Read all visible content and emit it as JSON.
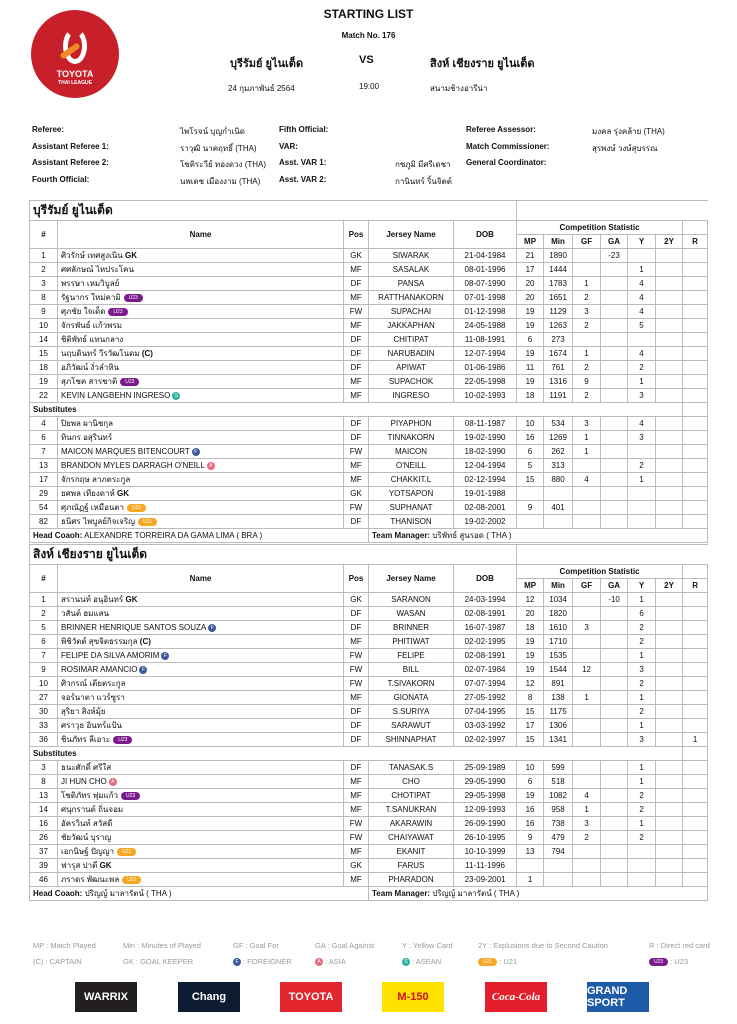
{
  "header": {
    "logo_text": "TOYOTA",
    "logo_sub": "THAI LEAGUE",
    "title": "STARTING LIST",
    "match_no": "Match No. 176",
    "home": "บุรีรัมย์ ยูไนเต็ด",
    "vs": "VS",
    "away": "สิงห์ เชียงราย ยูไนเต็ด",
    "date": "24 กุมภาพันธ์ 2564",
    "time": "19:00",
    "venue": "สนามช้างอารีน่า"
  },
  "officials": [
    {
      "label": "Referee:",
      "value": "ไพโรจน์ บุญก่ำเนิด"
    },
    {
      "label": "Assistant Referee 1:",
      "value": "ราวุฒิ นาคฤทธิ์ (THA)"
    },
    {
      "label": "Assistant Referee 2:",
      "value": "โชติระวีย์ ทองดวง (THA)"
    },
    {
      "label": "Fourth Official:",
      "value": "นพเดช เมืองงาม (THA)"
    },
    {
      "label": "Fifth Official:",
      "value": ""
    },
    {
      "label": "VAR:",
      "value": ""
    },
    {
      "label": "Asst. VAR 1:",
      "value": "กชภูมิ มีศรีเดชา"
    },
    {
      "label": "Asst. VAR 2:",
      "value": "กานินทร์ ริ้นจิตต์"
    },
    {
      "label": "Referee Assessor:",
      "value": "มงคล รุ่งคล้าย (THA)"
    },
    {
      "label": "Match Commissioner:",
      "value": "สุรพงษ์ วงษ์สุบรรณ"
    },
    {
      "label": "General Coordinator:",
      "value": ""
    }
  ],
  "columns": {
    "num": "#",
    "name": "Name",
    "pos": "Pos",
    "jersey": "Jersey Name",
    "dob": "DOB",
    "stat": "Competition Statistic",
    "mp": "MP",
    "min": "Min",
    "gf": "GF",
    "ga": "GA",
    "y": "Y",
    "y2": "2Y",
    "r": "R"
  },
  "subs_label": "Substitutes",
  "coach_label": "Head Coaoh:",
  "manager_label": "Team Manager:",
  "teams": [
    {
      "name": "บุรีรัมย์ ยูไนเต็ด",
      "coach": "ALEXANDRE TORREIRA DA GAMA LIMA ( BRA )",
      "manager": "บริพัทธ์ สูนรอด ( THA )",
      "starters": [
        [
          "1",
          "ศิวรักษ์ เทศสูงเนิน",
          "GK",
          "",
          "GK",
          "SIWARAK",
          "21-04-1984",
          "21",
          "1890",
          "",
          "-23",
          "",
          "",
          ""
        ],
        [
          "2",
          "ศศลักษณ์ ไหประโคน",
          "",
          "",
          "MF",
          "SASALAK",
          "08-01-1996",
          "17",
          "1444",
          "",
          "",
          "1",
          "",
          ""
        ],
        [
          "3",
          "พรรษา เหมวิบูลย์",
          "",
          "",
          "DF",
          "PANSA",
          "08-07-1990",
          "20",
          "1783",
          "1",
          "",
          "4",
          "",
          ""
        ],
        [
          "8",
          "รัฐนากร ใหม่คามิ",
          "",
          "U23",
          "MF",
          "RATTHANAKORN",
          "07-01-1998",
          "20",
          "1651",
          "2",
          "",
          "4",
          "",
          ""
        ],
        [
          "9",
          "ศุภชัย ใจเด็ด",
          "",
          "U23",
          "FW",
          "SUPACHAI",
          "01-12-1998",
          "19",
          "1129",
          "3",
          "",
          "4",
          "",
          ""
        ],
        [
          "10",
          "จักรพันธ์ แก้วพรม",
          "",
          "",
          "MF",
          "JAKKAPHAN",
          "24-05-1988",
          "19",
          "1263",
          "2",
          "",
          "5",
          "",
          ""
        ],
        [
          "14",
          "ชิติพัทธ์ แทนกลาง",
          "",
          "",
          "DF",
          "CHITIPAT",
          "11-08-1991",
          "6",
          "273",
          "",
          "",
          "",
          "",
          ""
        ],
        [
          "15",
          "นฤบดินทร์ วีรวัฒโนดม",
          "(C)",
          "",
          "DF",
          "NARUBADIN",
          "12-07-1994",
          "19",
          "1674",
          "1",
          "",
          "4",
          "",
          ""
        ],
        [
          "18",
          "อภิวัฒน์ งั่วลำหิน",
          "",
          "",
          "DF",
          "APIWAT",
          "01-06-1986",
          "11",
          "761",
          "2",
          "",
          "2",
          "",
          ""
        ],
        [
          "19",
          "สุภโชค สารชาติ",
          "",
          "U23",
          "MF",
          "SUPACHOK",
          "22-05-1998",
          "19",
          "1316",
          "9",
          "",
          "1",
          "",
          ""
        ],
        [
          "22",
          "KEVIN LANGBEHN INGRESO",
          "",
          "S",
          "MF",
          "INGRESO",
          "10-02-1993",
          "18",
          "1191",
          "2",
          "",
          "3",
          "",
          ""
        ]
      ],
      "subs": [
        [
          "4",
          "ปิยพล ผานิชกุล",
          "",
          "",
          "DF",
          "PIYAPHON",
          "08-11-1987",
          "10",
          "534",
          "3",
          "",
          "4",
          "",
          ""
        ],
        [
          "6",
          "ทินกร อสุรินทร์",
          "",
          "",
          "DF",
          "TINNAKORN",
          "19-02-1990",
          "16",
          "1269",
          "1",
          "",
          "3",
          "",
          ""
        ],
        [
          "7",
          "MAICON MARQUES BITENCOURT",
          "",
          "F",
          "FW",
          "MAICON",
          "18-02-1990",
          "6",
          "262",
          "1",
          "",
          "",
          "",
          ""
        ],
        [
          "13",
          "BRANDON MYLES DARRAGH O'NEILL",
          "",
          "A",
          "MF",
          "O'NEILL",
          "12-04-1994",
          "5",
          "313",
          "",
          "",
          "2",
          "",
          ""
        ],
        [
          "17",
          "จักรกฤษ ลาภตระกูล",
          "",
          "",
          "MF",
          "CHAKKIT.L",
          "02-12-1994",
          "15",
          "880",
          "4",
          "",
          "1",
          "",
          ""
        ],
        [
          "29",
          "ยศพล เทียงดาห์",
          "GK",
          "",
          "GK",
          "YOTSAPON",
          "19-01-1988",
          "",
          "",
          "",
          "",
          "",
          "",
          ""
        ],
        [
          "54",
          "ศุภณัฏฐ์ เหมือนตา",
          "",
          "U21",
          "FW",
          "SUPHANAT",
          "02-08-2001",
          "9",
          "401",
          "",
          "",
          "",
          "",
          ""
        ],
        [
          "82",
          "ธนิศร ไพบูลย์กิจเจริญ",
          "",
          "U21",
          "DF",
          "THANISON",
          "19-02-2002",
          "",
          "",
          "",
          "",
          "",
          "",
          ""
        ]
      ]
    },
    {
      "name": "สิงห์ เชียงราย ยูไนเต็ด",
      "coach": "ปริญญ์ มาลารัตน์ ( THA )",
      "manager": "ปริญญ์ มาลารัตน์ ( THA )",
      "starters": [
        [
          "1",
          "สรานนท์ อนุอินทร์",
          "GK",
          "",
          "GK",
          "SARANON",
          "24-03-1994",
          "12",
          "1034",
          "",
          "-10",
          "1",
          "",
          ""
        ],
        [
          "2",
          "วสันต์ ฮมแสน",
          "",
          "",
          "DF",
          "WASAN",
          "02-08-1991",
          "20",
          "1820",
          "",
          "",
          "6",
          "",
          ""
        ],
        [
          "5",
          "BRINNER HENRIQUE SANTOS SOUZA",
          "",
          "F",
          "DF",
          "BRINNER",
          "16-07-1987",
          "18",
          "1610",
          "3",
          "",
          "2",
          "",
          ""
        ],
        [
          "6",
          "พิชิวัตต์ สุขจิตธรรมกุล",
          "(C)",
          "",
          "MF",
          "PHITIWAT",
          "02-02-1995",
          "19",
          "1710",
          "",
          "",
          "2",
          "",
          ""
        ],
        [
          "7",
          "FELIPE DA SILVA AMORIM",
          "",
          "F",
          "FW",
          "FELIPE",
          "02-08-1991",
          "19",
          "1535",
          "",
          "",
          "1",
          "",
          ""
        ],
        [
          "9",
          "ROSIMAR AMANCIO",
          "",
          "F",
          "FW",
          "BILL",
          "02-07-1984",
          "19",
          "1544",
          "12",
          "",
          "3",
          "",
          ""
        ],
        [
          "10",
          "ศิวกรณ์ เตียตระกูล",
          "",
          "",
          "FW",
          "T.SIVAKORN",
          "07-07-1994",
          "12",
          "891",
          "",
          "",
          "2",
          "",
          ""
        ],
        [
          "27",
          "จอร์นาตา แวร์ซูรา",
          "",
          "",
          "MF",
          "GIONATA",
          "27-05-1992",
          "8",
          "138",
          "1",
          "",
          "1",
          "",
          ""
        ],
        [
          "30",
          "สุริยา สิงห์มุ้ย",
          "",
          "",
          "DF",
          "S.SURIYA",
          "07-04-1995",
          "15",
          "1175",
          "",
          "",
          "2",
          "",
          ""
        ],
        [
          "33",
          "ศราวุธ อินทร์แป้น",
          "",
          "",
          "DF",
          "SARAWUT",
          "03-03-1992",
          "17",
          "1306",
          "",
          "",
          "1",
          "",
          ""
        ],
        [
          "36",
          "ชินภัทร ลีเอาะ",
          "",
          "U23",
          "DF",
          "SHINNAPHAT",
          "02-02-1997",
          "15",
          "1341",
          "",
          "",
          "3",
          "",
          "1"
        ]
      ],
      "subs": [
        [
          "3",
          "ธนะศักดิ์ ศรีใส",
          "",
          "",
          "DF",
          "TANASAK.S",
          "25-09-1989",
          "10",
          "599",
          "",
          "",
          "1",
          "",
          ""
        ],
        [
          "8",
          "JI HUN CHO",
          "",
          "A",
          "MF",
          "CHO",
          "29-05-1990",
          "6",
          "518",
          "",
          "",
          "1",
          "",
          ""
        ],
        [
          "13",
          "โชติภัทร พุ่มแก้ว",
          "",
          "U23",
          "MF",
          "CHOTIPAT",
          "29-05-1998",
          "19",
          "1082",
          "4",
          "",
          "2",
          "",
          ""
        ],
        [
          "14",
          "ศนุกรานต์ ถิ่นจอม",
          "",
          "",
          "MF",
          "T.SANUKRAN",
          "12-09-1993",
          "16",
          "958",
          "1",
          "",
          "2",
          "",
          ""
        ],
        [
          "16",
          "อัครวินท์ สวัสดี",
          "",
          "",
          "FW",
          "AKARAWIN",
          "26-09-1990",
          "16",
          "738",
          "3",
          "",
          "1",
          "",
          ""
        ],
        [
          "26",
          "ชัยวัฒน์ บุราญ",
          "",
          "",
          "FW",
          "CHAIYAWAT",
          "26-10-1995",
          "9",
          "479",
          "2",
          "",
          "2",
          "",
          ""
        ],
        [
          "37",
          "เอกนิษฐ์ ปัญญา",
          "",
          "U21",
          "MF",
          "EKANIT",
          "10-10-1999",
          "13",
          "794",
          "",
          "",
          "",
          "",
          ""
        ],
        [
          "39",
          "ฟารุส ปาตี",
          "GK",
          "",
          "GK",
          "FARUS",
          "11-11-1996",
          "",
          "",
          "",
          "",
          "",
          "",
          ""
        ],
        [
          "46",
          "ภราดร พัฒนะพล",
          "",
          "U21",
          "MF",
          "PHARADON",
          "23-09-2001",
          "1",
          "",
          "",
          "",
          "",
          "",
          ""
        ]
      ]
    }
  ],
  "badges": {
    "U23": "U23",
    "U21": "U21",
    "F": "F",
    "A": "A",
    "S": "S"
  },
  "legend": {
    "row1": [
      "MP : Match Played",
      "Min : Minutes of Played",
      "GF : Goal For",
      "GA : Goal Against",
      "Y : Yellow Card",
      "2Y : Explusions due to Second Caution",
      "R : Direct red card"
    ],
    "row2": [
      "(C) : CAPTAIN",
      "GK : GOAL KEEPER",
      ": FOREIGNER",
      ": ASIA",
      ": ASEAN",
      ": U21",
      ": U23"
    ]
  },
  "sponsors": [
    {
      "name": "WARRIX",
      "color": "#231f20"
    },
    {
      "name": "Chang",
      "color": "#0d1b33"
    },
    {
      "name": "TOYOTA",
      "color": "#e3262d"
    },
    {
      "name": "M-150",
      "color": "#ffe100"
    },
    {
      "name": "Coca-Cola",
      "color": "#e41e2b"
    },
    {
      "name": "GRAND SPORT",
      "color": "#1d5aa8"
    }
  ]
}
